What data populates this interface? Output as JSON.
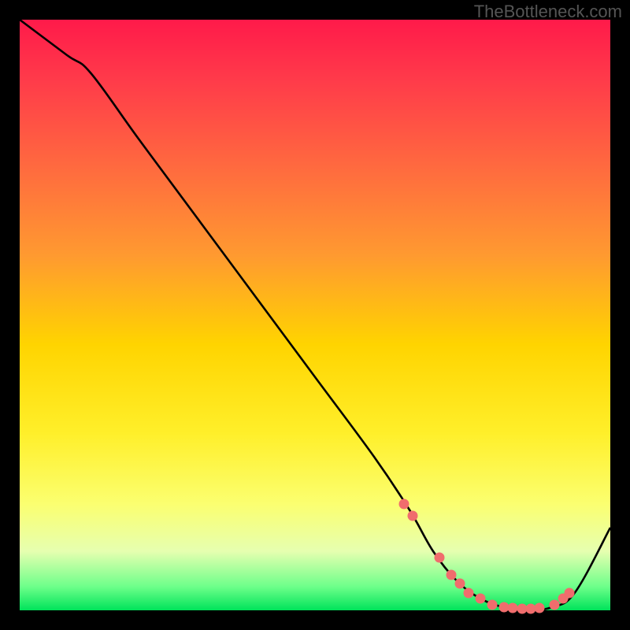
{
  "attribution": "TheBottleneck.com",
  "chart_data": {
    "type": "line",
    "title": "",
    "xlabel": "",
    "ylabel": "",
    "xlim": [
      0,
      100
    ],
    "ylim": [
      0,
      100
    ],
    "curve": {
      "x": [
        0,
        8,
        12,
        20,
        30,
        40,
        50,
        60,
        66,
        70,
        74,
        78,
        82,
        86,
        90,
        94,
        100
      ],
      "y": [
        100,
        94,
        91,
        80,
        66.5,
        53,
        39.5,
        26,
        17,
        10,
        5,
        2,
        0.5,
        0,
        0.5,
        3,
        14
      ]
    },
    "markers": {
      "x": [
        65,
        66.5,
        71,
        73,
        74.5,
        76,
        78,
        80,
        82,
        83.5,
        85,
        86.5,
        88,
        90.5,
        92,
        93
      ],
      "y": [
        18,
        16,
        9,
        6,
        4.5,
        3,
        2,
        1,
        0.6,
        0.4,
        0.3,
        0.3,
        0.4,
        1,
        2,
        3
      ]
    }
  },
  "colors": {
    "curve_stroke": "#000000",
    "marker_fill": "#f06d6d"
  }
}
